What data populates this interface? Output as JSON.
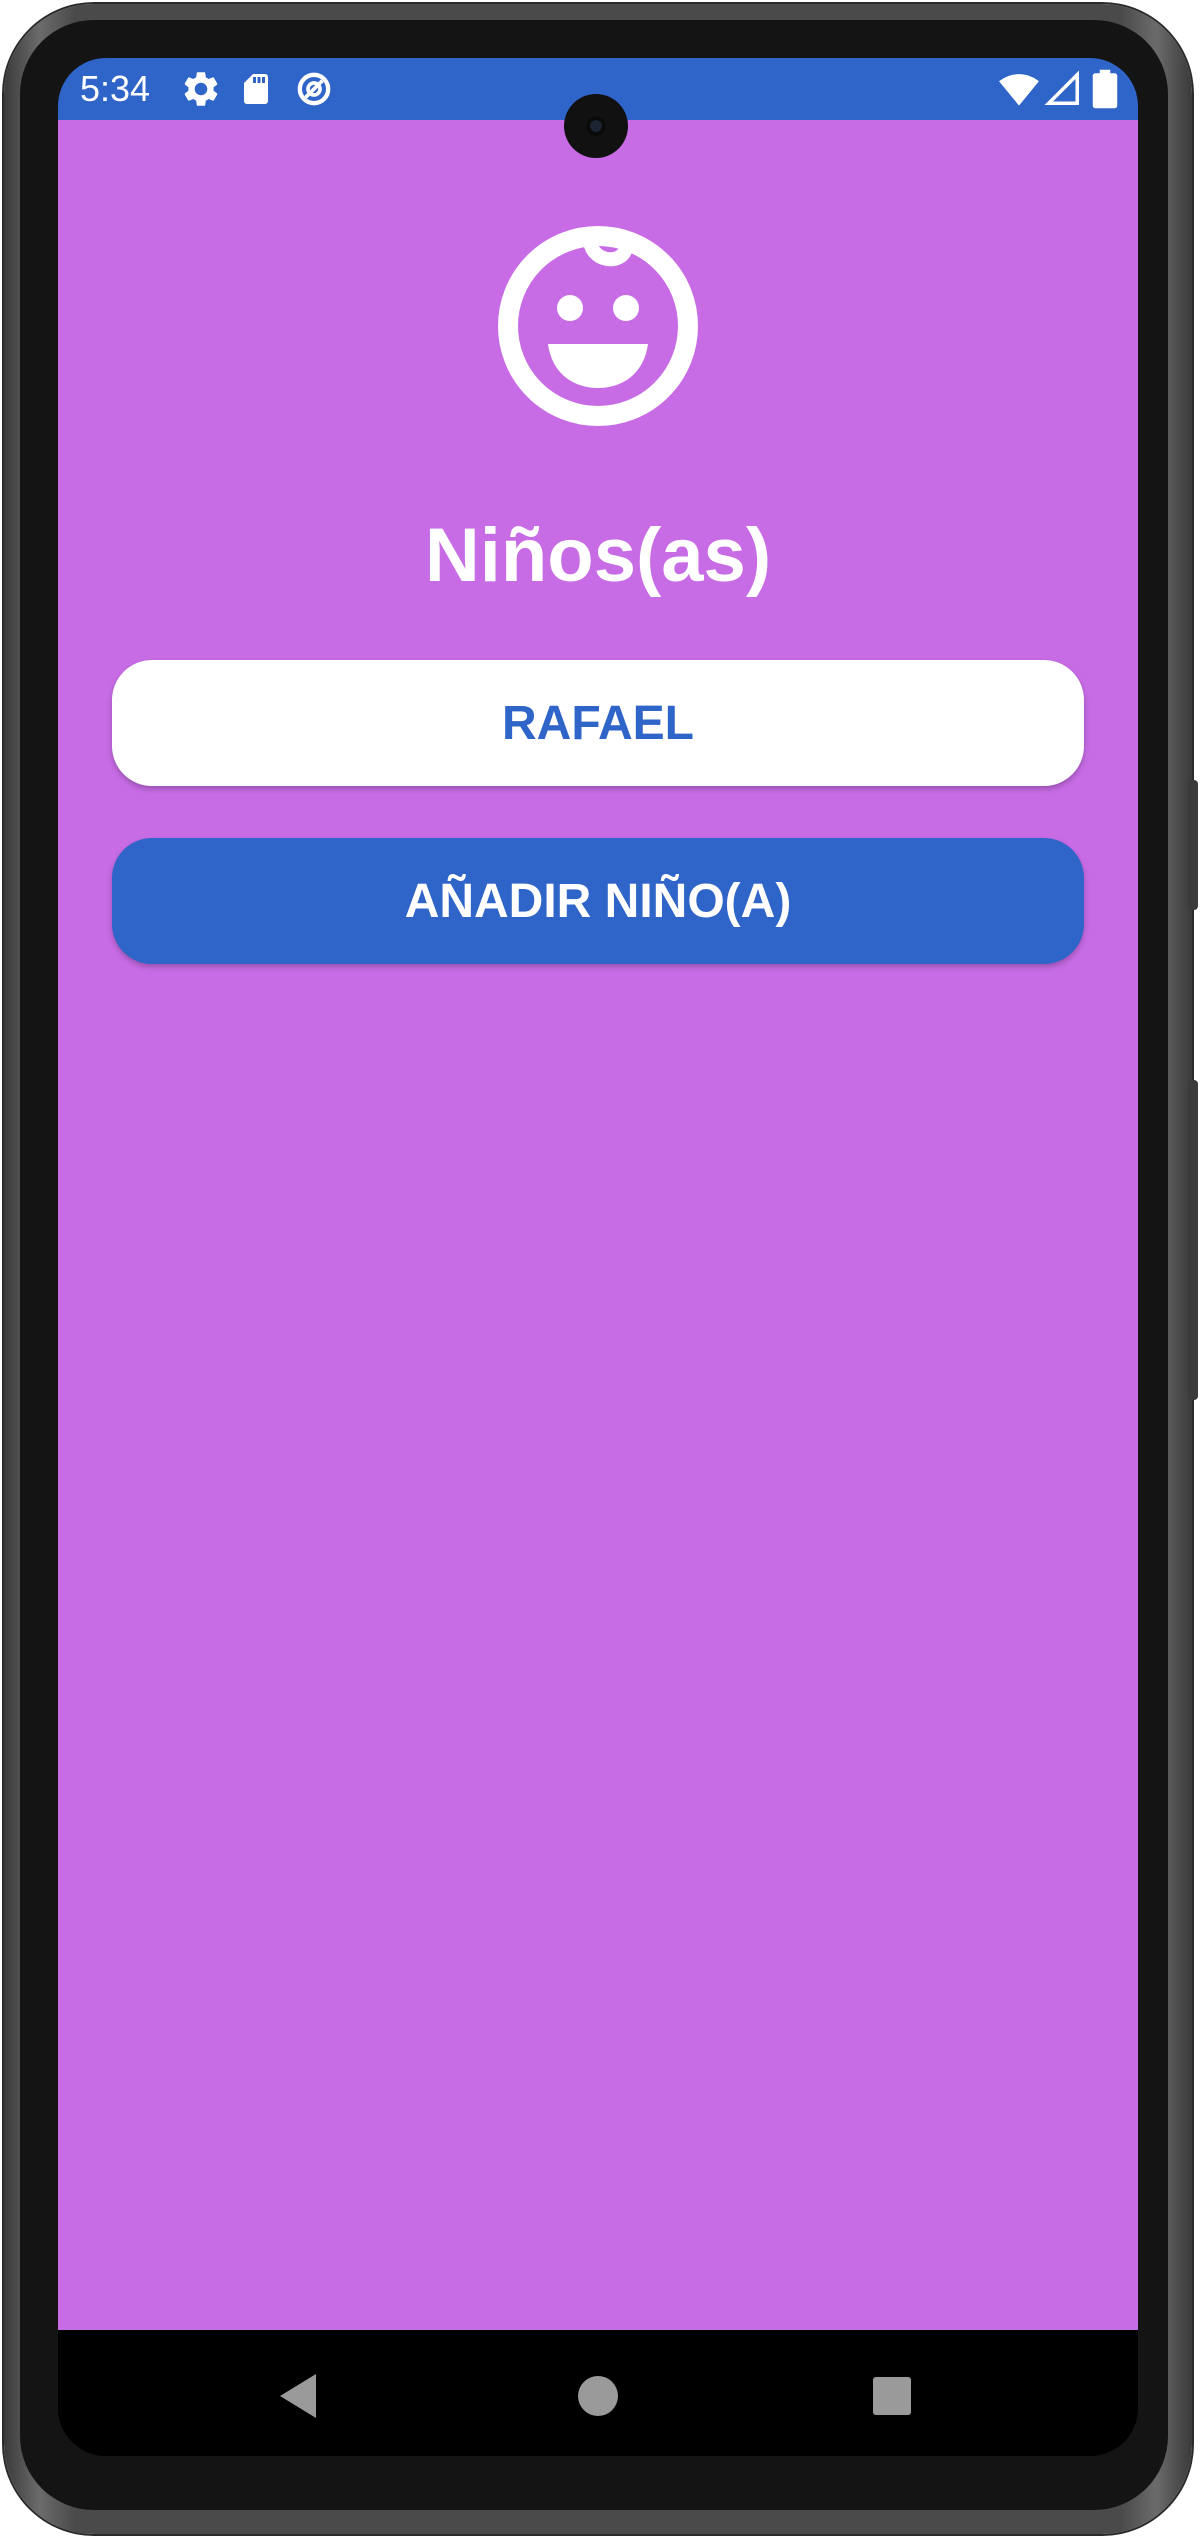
{
  "status_bar": {
    "time": "5:34",
    "left_icons": [
      "gear-icon",
      "sd-card-icon",
      "data-saver-icon"
    ],
    "right_icons": [
      "wifi-icon",
      "cellular-signal-icon",
      "battery-icon"
    ],
    "color": "#2f64c8"
  },
  "screen": {
    "background_color": "#c86ce6",
    "header": {
      "icon": "baby-face-icon",
      "title": "Niños(as)"
    },
    "children": [
      {
        "label": "RAFAEL"
      }
    ],
    "add_button": {
      "label": "AÑADIR NIÑO(A)",
      "color": "#2f64c8"
    }
  },
  "navigation_bar": {
    "buttons": [
      "back-icon",
      "home-icon",
      "recents-icon"
    ]
  }
}
